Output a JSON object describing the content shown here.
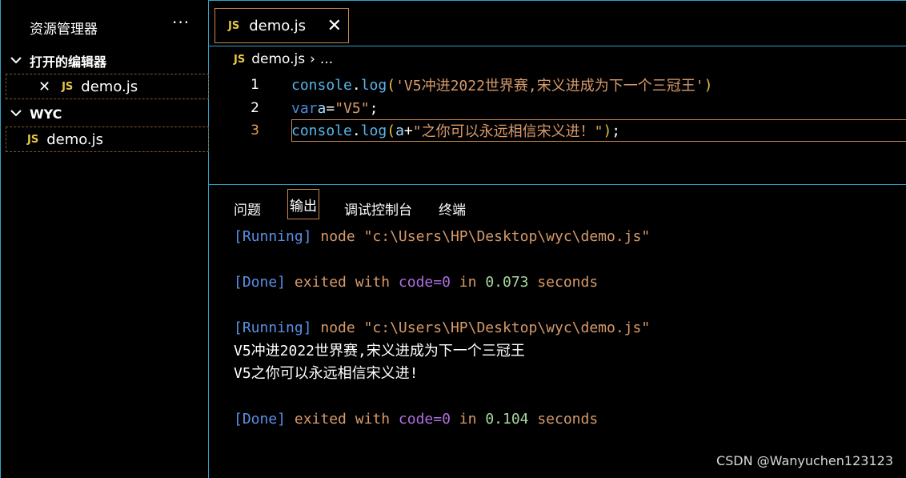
{
  "sidebar": {
    "title": "资源管理器",
    "more": "···",
    "open_editors_label": "打开的编辑器",
    "open_editor_file": "demo.js",
    "folder_label": "WYC",
    "folder_file": "demo.js"
  },
  "tabs": [
    {
      "label": "demo.js",
      "badge": "JS"
    }
  ],
  "breadcrumb": {
    "file": "demo.js",
    "sep": "›",
    "rest": "..."
  },
  "editor": {
    "line_numbers": [
      "1",
      "2",
      "3"
    ],
    "line1": [
      "console",
      ".",
      "log",
      "(",
      "'V5冲进2022世界赛,宋义进成为下一个三冠王'",
      ")"
    ],
    "line2": [
      "var",
      " ",
      "a",
      "=",
      "\"V5\"",
      ";"
    ],
    "line3": [
      "console",
      ".",
      "log",
      "(",
      "a",
      "+",
      "\"之你可以永远相信宋义进！\"",
      ")",
      ";"
    ]
  },
  "panel_tabs": [
    "问题",
    "输出",
    "调试控制台",
    "终端"
  ],
  "output": {
    "run1": {
      "tag": "[Running]",
      "cmd": " node \"c:\\Users\\HP\\Desktop\\wyc\\demo.js\""
    },
    "done1": {
      "tag": "[Done]",
      "a": " exited with ",
      "code": "code=0",
      "b": " in ",
      "num": "0.073",
      "c": " seconds"
    },
    "run2": {
      "tag": "[Running]",
      "cmd": " node \"c:\\Users\\HP\\Desktop\\wyc\\demo.js\""
    },
    "out1": "V5冲进2022世界赛,宋义进成为下一个三冠王",
    "out2": "V5之你可以永远相信宋义进!",
    "done2": {
      "tag": "[Done]",
      "a": " exited with ",
      "code": "code=0",
      "b": " in ",
      "num": "0.104",
      "c": " seconds"
    }
  },
  "watermark": "CSDN @Wanyuchen123123"
}
